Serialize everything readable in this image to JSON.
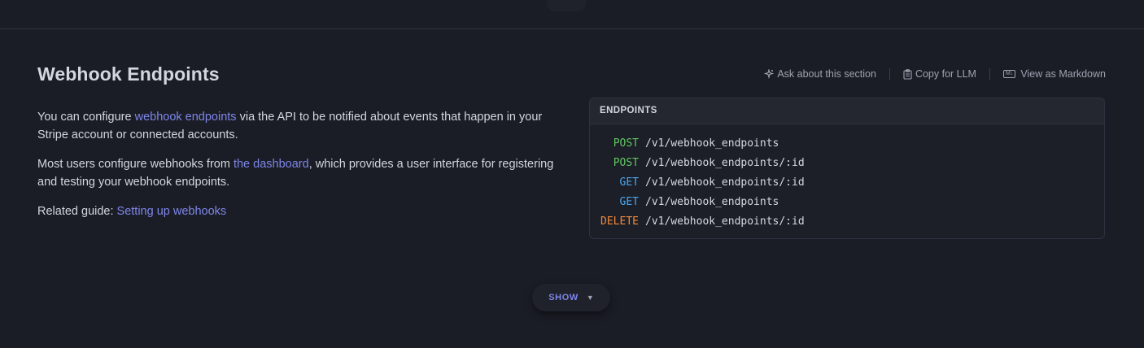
{
  "section": {
    "title": "Webhook Endpoints"
  },
  "actions": {
    "ask": "Ask about this section",
    "copy": "Copy for LLM",
    "view_md": "View as Markdown",
    "md_badge": "M↓"
  },
  "description": {
    "p1_before": "You can configure ",
    "p1_link": "webhook endpoints",
    "p1_after": " via the API to be notified about events that happen in your Stripe account or connected accounts.",
    "p2_before": "Most users configure webhooks from ",
    "p2_link": "the dashboard",
    "p2_after": ", which provides a user interface for registering and testing your webhook endpoints.",
    "p3_before": "Related guide: ",
    "p3_link": "Setting up webhooks"
  },
  "endpoints": {
    "header": "ENDPOINTS",
    "rows": [
      {
        "method": "POST",
        "path": "/v1/webhook_endpoints"
      },
      {
        "method": "POST",
        "path": "/v1/webhook_endpoints/:id"
      },
      {
        "method": "GET",
        "path": "/v1/webhook_endpoints/:id"
      },
      {
        "method": "GET",
        "path": "/v1/webhook_endpoints"
      },
      {
        "method": "DELETE",
        "path": "/v1/webhook_endpoints/:id"
      }
    ]
  },
  "method_colors": {
    "POST": "#5fc65f",
    "GET": "#4aa6f0",
    "DELETE": "#f08a3c"
  },
  "show_button": {
    "label": "SHOW",
    "caret": "▼"
  }
}
